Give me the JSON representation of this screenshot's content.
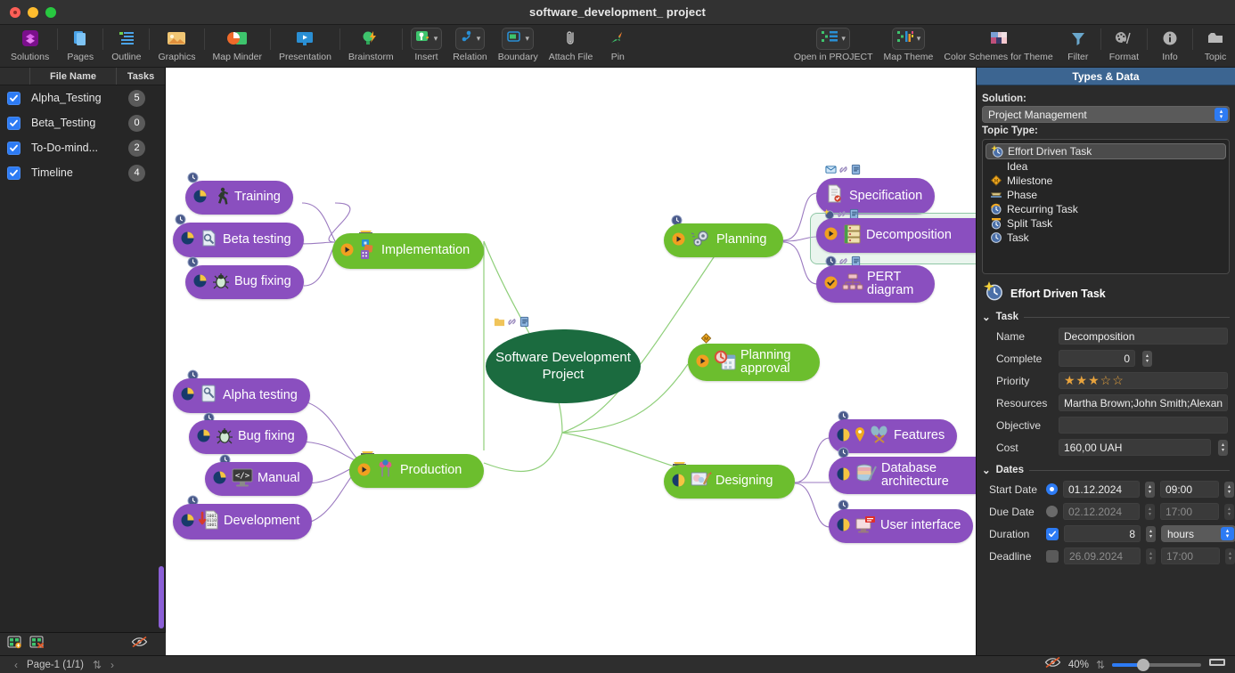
{
  "window": {
    "title": "software_development_ project"
  },
  "toolbar": {
    "items": [
      {
        "label": "Solutions",
        "icon": "solutions-icon",
        "dropdown": false
      },
      {
        "label": "Pages",
        "icon": "pages-icon",
        "dropdown": false
      },
      {
        "label": "Outline",
        "icon": "outline-icon",
        "dropdown": false
      },
      {
        "label": "Graphics",
        "icon": "graphics-icon",
        "dropdown": false
      },
      {
        "label": "Map Minder",
        "icon": "map-minder-icon",
        "dropdown": false
      },
      {
        "label": "Presentation",
        "icon": "presentation-icon",
        "dropdown": false
      },
      {
        "label": "Brainstorm",
        "icon": "brainstorm-icon",
        "dropdown": false
      },
      {
        "label": "Insert",
        "icon": "insert-icon",
        "dropdown": true
      },
      {
        "label": "Relation",
        "icon": "relation-icon",
        "dropdown": true
      },
      {
        "label": "Boundary",
        "icon": "boundary-icon",
        "dropdown": true
      },
      {
        "label": "Attach File",
        "icon": "attach-file-icon",
        "dropdown": false
      },
      {
        "label": "Pin",
        "icon": "pin-icon",
        "dropdown": false
      },
      {
        "label": "Open in PROJECT",
        "icon": "open-in-project-icon",
        "dropdown": true
      },
      {
        "label": "Map Theme",
        "icon": "map-theme-icon",
        "dropdown": true
      },
      {
        "label": "Color Schemes for Theme",
        "icon": "color-schemes-icon",
        "dropdown": false
      },
      {
        "label": "Filter",
        "icon": "filter-icon",
        "dropdown": false
      },
      {
        "label": "Format",
        "icon": "format-icon",
        "dropdown": false
      },
      {
        "label": "Info",
        "icon": "info-icon",
        "dropdown": false
      },
      {
        "label": "Topic",
        "icon": "topic-icon",
        "dropdown": false
      }
    ]
  },
  "left_panel": {
    "columns": {
      "file_name": "File Name",
      "tasks": "Tasks"
    },
    "rows": [
      {
        "checked": true,
        "name": "Alpha_Testing",
        "tasks": "5"
      },
      {
        "checked": true,
        "name": "Beta_Testing",
        "tasks": "0"
      },
      {
        "checked": true,
        "name": "To-Do-mind...",
        "tasks": "2"
      },
      {
        "checked": true,
        "name": "Timeline",
        "tasks": "4"
      }
    ],
    "footer_icons": [
      "add-map-icon",
      "remove-map-icon",
      "hide-icon"
    ]
  },
  "mindmap": {
    "central": {
      "label": "Software Development Project",
      "color": "#1b6b3f"
    },
    "colors": {
      "purple": "#8a4fbf",
      "green": "#6cbe2e",
      "central": "#1b6b3f",
      "link": "#9b7ac0",
      "link_green": "#8fcf7a"
    },
    "branches": [
      {
        "name": "Implementation",
        "color": "green",
        "icon": "implementation-icon",
        "children": [
          {
            "name": "Training",
            "icon": "runner-icon",
            "badge": "clock-icon"
          },
          {
            "name": "Beta testing",
            "icon": "beta-doc-icon",
            "badge": "clock-icon"
          },
          {
            "name": "Bug fixing",
            "icon": "bug-icon",
            "badge": "clock-icon"
          }
        ]
      },
      {
        "name": "Production",
        "color": "green",
        "icon": "production-icon",
        "children": [
          {
            "name": "Alpha testing",
            "icon": "alpha-doc-icon",
            "badge": "clock-icon"
          },
          {
            "name": "Bug fixing",
            "icon": "bug-icon",
            "badge": "clock-icon"
          },
          {
            "name": "Manual",
            "icon": "code-monitor-icon",
            "badge": "clock-icon"
          },
          {
            "name": "Development",
            "icon": "binary-doc-icon",
            "badge": "clock-icon"
          }
        ]
      },
      {
        "name": "Planning",
        "color": "green",
        "icon": "planning-gears-icon",
        "children": [
          {
            "name": "Specification",
            "icon": "certificate-icon",
            "badge": "mail-icon"
          },
          {
            "name": "Decomposition",
            "icon": "list-stack-icon",
            "badge": "spark-icon",
            "selected": true
          },
          {
            "name": "PERT diagram",
            "icon": "pert-icon",
            "badge": "clock-icon"
          }
        ]
      },
      {
        "name": "Planning approval",
        "color": "green",
        "icon": "approval-calendar-icon",
        "children": []
      },
      {
        "name": "Designing",
        "color": "green",
        "icon": "designing-palette-icon",
        "children": [
          {
            "name": "Features",
            "icon": "features-icon",
            "badge": "clock-icon"
          },
          {
            "name": "Database architecture",
            "icon": "database-icon",
            "badge": "clock-icon"
          },
          {
            "name": "User interface",
            "icon": "ui-icon",
            "badge": "clock-icon"
          }
        ]
      }
    ]
  },
  "right_panel": {
    "title": "Types & Data",
    "solution_label": "Solution:",
    "solution_value": "Project Management",
    "topic_type_label": "Topic Type:",
    "topic_types": [
      {
        "label": "Effort Driven Task",
        "icon": "effort-driven-task-icon",
        "selected": true
      },
      {
        "label": "Idea",
        "icon": "",
        "selected": false
      },
      {
        "label": "Milestone",
        "icon": "milestone-icon",
        "selected": false
      },
      {
        "label": "Phase",
        "icon": "phase-icon",
        "selected": false
      },
      {
        "label": "Recurring Task",
        "icon": "recurring-task-icon",
        "selected": false
      },
      {
        "label": "Split Task",
        "icon": "split-task-icon",
        "selected": false
      },
      {
        "label": "Task",
        "icon": "task-icon",
        "selected": false
      }
    ],
    "selected_type": "Effort Driven Task",
    "task_section": "Task",
    "fields": {
      "name_label": "Name",
      "name_value": "Decomposition",
      "complete_label": "Complete",
      "complete_value": "0",
      "priority_label": "Priority",
      "priority_stars": 3,
      "priority_max": 5,
      "resources_label": "Resources",
      "resources_value": "Martha Brown;John Smith;Alexan",
      "objective_label": "Objective",
      "objective_value": "",
      "cost_label": "Cost",
      "cost_value": "160,00 UAH"
    },
    "dates_section": "Dates",
    "dates": {
      "start_label": "Start Date",
      "start_on": true,
      "start_value": "01.12.2024",
      "start_time": "09:00",
      "due_label": "Due Date",
      "due_on": false,
      "due_value": "02.12.2024",
      "due_time": "17:00",
      "duration_label": "Duration",
      "duration_on": true,
      "duration_value": "8",
      "duration_unit": "hours",
      "deadline_label": "Deadline",
      "deadline_on": false,
      "deadline_value": "26.09.2024",
      "deadline_time": "17:00"
    }
  },
  "status_bar": {
    "page_label": "Page-1 (1/1)",
    "zoom": "40%",
    "prev_icon": "chevron-left-icon",
    "next_icon": "chevron-right-icon",
    "eye_icon": "hide-icon",
    "fit_icon": "fit-page-icon"
  }
}
